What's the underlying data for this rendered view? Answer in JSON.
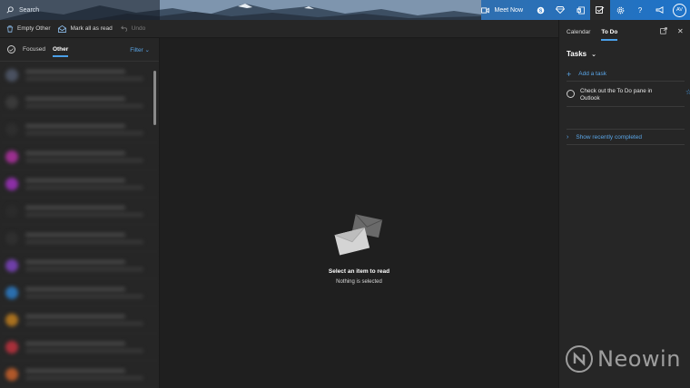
{
  "header": {
    "search_placeholder": "Search",
    "meet_now": "Meet Now",
    "avatar_initials": "AV"
  },
  "command_bar": {
    "empty_folder": "Empty Other",
    "mark_all_read": "Mark all as read",
    "undo": "Undo"
  },
  "message_list": {
    "tab_focused": "Focused",
    "tab_other": "Other",
    "filter": "Filter",
    "blurred_avatar_colors": [
      "#4a5160",
      "#3a3a3a",
      "#2e2e2e",
      "#9b2f8f",
      "#8c2fa6",
      "#2b2b2b",
      "#2f2f2f",
      "#6f3fa8",
      "#2b6fae",
      "#a8701f",
      "#a8303a",
      "#b0582a"
    ]
  },
  "reading_pane": {
    "title": "Select an item to read",
    "subtitle": "Nothing is selected"
  },
  "todo_pane": {
    "tab_calendar": "Calendar",
    "tab_todo": "To Do",
    "list_title": "Tasks",
    "add_task": "Add a task",
    "task_text": "Check out the To Do pane in Outlook",
    "show_completed": "Show recently completed"
  },
  "watermark": {
    "text": "Neowin"
  },
  "colors": {
    "accent": "#4a9fe8",
    "background": "#1f1f1f",
    "pane": "#262626"
  }
}
